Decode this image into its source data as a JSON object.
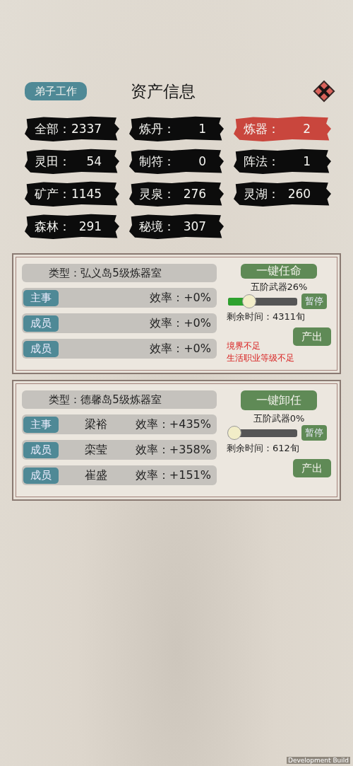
{
  "header": {
    "back_button": "弟子工作",
    "title": "资产信息"
  },
  "categories": [
    {
      "label": "全部：",
      "count": "2337",
      "selected": false
    },
    {
      "label": "炼丹：",
      "count": "1",
      "selected": false
    },
    {
      "label": "炼器：",
      "count": "2",
      "selected": true
    },
    {
      "label": "灵田：",
      "count": "54",
      "selected": false
    },
    {
      "label": "制符：",
      "count": "0",
      "selected": false
    },
    {
      "label": "阵法：",
      "count": "1",
      "selected": false
    },
    {
      "label": "矿产：",
      "count": "1145",
      "selected": false
    },
    {
      "label": "灵泉：",
      "count": "276",
      "selected": false
    },
    {
      "label": "灵湖：",
      "count": "260",
      "selected": false
    },
    {
      "label": "森林：",
      "count": "291",
      "selected": false
    },
    {
      "label": "秘境：",
      "count": "307",
      "selected": false
    }
  ],
  "workshops": [
    {
      "type": "类型：弘义岛5级炼器室",
      "members": [
        {
          "role": "主事",
          "efficiency": "效率：+0%"
        },
        {
          "role": "成员",
          "efficiency": "效率：+0%"
        },
        {
          "role": "成员",
          "efficiency": "效率：+0%"
        }
      ],
      "action_button": "一键任命",
      "product": "五阶武器26%",
      "level": 0.26,
      "pause_button": "暂停",
      "remaining": "剩余时间：4311旬",
      "output_button": "产出",
      "warnings": [
        "境界不足",
        "生活职业等级不足"
      ]
    },
    {
      "type": "类型：德馨岛5级炼器室",
      "members": [
        {
          "role": "主事",
          "name": "梁裕",
          "efficiency": "效率：+435%"
        },
        {
          "role": "成员",
          "name": "栾莹",
          "efficiency": "效率：+358%"
        },
        {
          "role": "成员",
          "name": "崔盛",
          "efficiency": "效率：+151%"
        }
      ],
      "action_button": "一键卸任",
      "product": "五阶武器0%",
      "level": 0,
      "pause_button": "暂停",
      "remaining": "剩余时间：612旬",
      "output_button": "产出"
    }
  ],
  "footer_note": "Development Build"
}
